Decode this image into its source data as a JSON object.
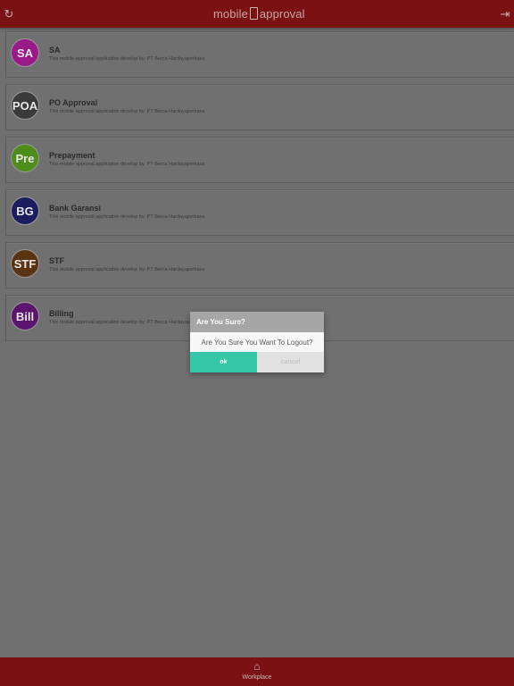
{
  "header": {
    "logo_left": "mobile",
    "logo_right": "approval",
    "refresh_icon": "refresh-icon",
    "logout_icon": "logout-icon"
  },
  "apps": [
    {
      "badge": "SA",
      "title": "SA",
      "subtitle": "This mobile approval application develop by: PT Berca Hardayaperkasa",
      "color": "#9b1a8a"
    },
    {
      "badge": "POA",
      "title": "PO Approval",
      "subtitle": "This mobile approval application develop by: PT Berca Hardayaperkasa",
      "color": "#3a3a3a"
    },
    {
      "badge": "Pre",
      "title": "Prepayment",
      "subtitle": "This mobile approval application develop by: PT Berca Hardayaperkasa",
      "color": "#4f8d1b"
    },
    {
      "badge": "BG",
      "title": "Bank Garansi",
      "subtitle": "This mobile approval application develop by: PT Berca Hardayaperkasa",
      "color": "#1a1e5e"
    },
    {
      "badge": "STF",
      "title": "STF",
      "subtitle": "This mobile approval application develop by: PT Berca Hardayaperkasa",
      "color": "#5a3410"
    },
    {
      "badge": "Bill",
      "title": "Billing",
      "subtitle": "This mobile approval application develop by: PT Berca Hardayaperkasa",
      "color": "#5b1470"
    }
  ],
  "dialog": {
    "title": "Are You Sure?",
    "message": "Are You Sure You Want To Logout?",
    "ok": "ok",
    "cancel": "cancel"
  },
  "footer": {
    "tab_label": "Workplace",
    "tab_icon": "home-icon"
  }
}
